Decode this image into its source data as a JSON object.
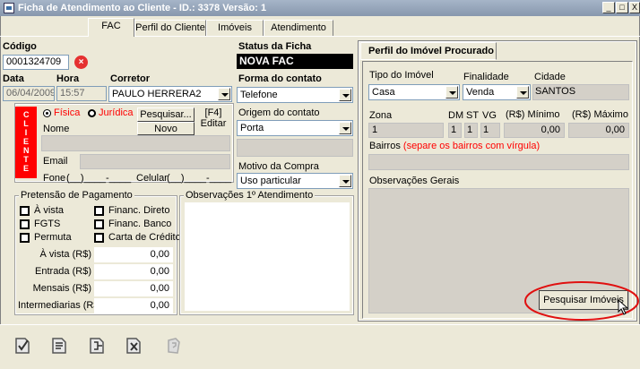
{
  "window": {
    "title": "Ficha de Atendimento ao Cliente - ID.: 3378 Versão: 1",
    "btn_min": "_",
    "btn_max": "□",
    "btn_close": "X"
  },
  "tabs": [
    "FAC",
    "Perfil do Cliente",
    "Imóveis",
    "Atendimento"
  ],
  "header": {
    "codigo_label": "Código",
    "codigo_value": "0001324709",
    "data_label": "Data",
    "hora_label": "Hora",
    "corretor_label": "Corretor",
    "data_value": "06/04/2009",
    "hora_value": "15:57",
    "corretor_value": "PAULO HERRERA2",
    "status_label": "Status da Ficha",
    "status_value": "NOVA FAC",
    "forma_label": "Forma do contato",
    "forma_value": "Telefone",
    "origem_label": "Origem do contato",
    "origem_value": "Porta",
    "motivo_label": "Motivo da Compra",
    "motivo_value": "Uso particular"
  },
  "cliente": {
    "band_text": "CLIENTE",
    "fisica": "Física",
    "juridica": "Jurídica",
    "pesquisar": "Pesquisar...",
    "f4": "[F4]",
    "editar": "Editar",
    "nome_label": "Nome",
    "novo": "Novo",
    "email_label": "Email",
    "fone_label": "Fone",
    "fone_value": "(__)____-____",
    "celular_label": "Celular",
    "celular_value": "(__)____-____"
  },
  "pagamento": {
    "legend": "Pretensão de Pagamento",
    "checks": [
      "À vista",
      "FGTS",
      "Permuta",
      "Financ. Direto",
      "Financ. Banco",
      "Carta de Crédito"
    ],
    "fields": [
      {
        "label": "À vista (R$)",
        "value": "0,00"
      },
      {
        "label": "Entrada (R$)",
        "value": "0,00"
      },
      {
        "label": "Mensais (R$)",
        "value": "0,00"
      },
      {
        "label": "Intermediarias (R$)",
        "value": "0,00"
      }
    ]
  },
  "observacoes": {
    "legend": "Observações 1º Atendimento"
  },
  "perfil": {
    "tab_title": "Perfil do Imóvel Procurado",
    "tipo_label": "Tipo do Imóvel",
    "tipo_value": "Casa",
    "finalidade_label": "Finalidade",
    "finalidade_value": "Venda",
    "cidade_label": "Cidade",
    "cidade_value": "SANTOS",
    "zona_label": "Zona",
    "zona_value": "1",
    "dm_label": "DM",
    "st_label": "ST",
    "vg_label": "VG",
    "dm_value": "1",
    "st_value": "1",
    "vg_value": "1",
    "min_label": "(R$) Mínimo",
    "max_label": "(R$) Máximo",
    "min_value": "0,00",
    "max_value": "0,00",
    "bairros_label": "Bairros",
    "bairros_hint": "(separe os bairros com vírgula)",
    "obs_label": "Observações Gerais",
    "pesquisar_imoveis": "Pesquisar Imóveis"
  },
  "toolbar_icons": [
    "confirm-doc-icon",
    "edit-doc-icon",
    "export-doc-icon",
    "delete-doc-icon",
    "help-doc-icon"
  ],
  "colors": {
    "accent_red": "#ff0000",
    "status_bg": "#000000"
  }
}
